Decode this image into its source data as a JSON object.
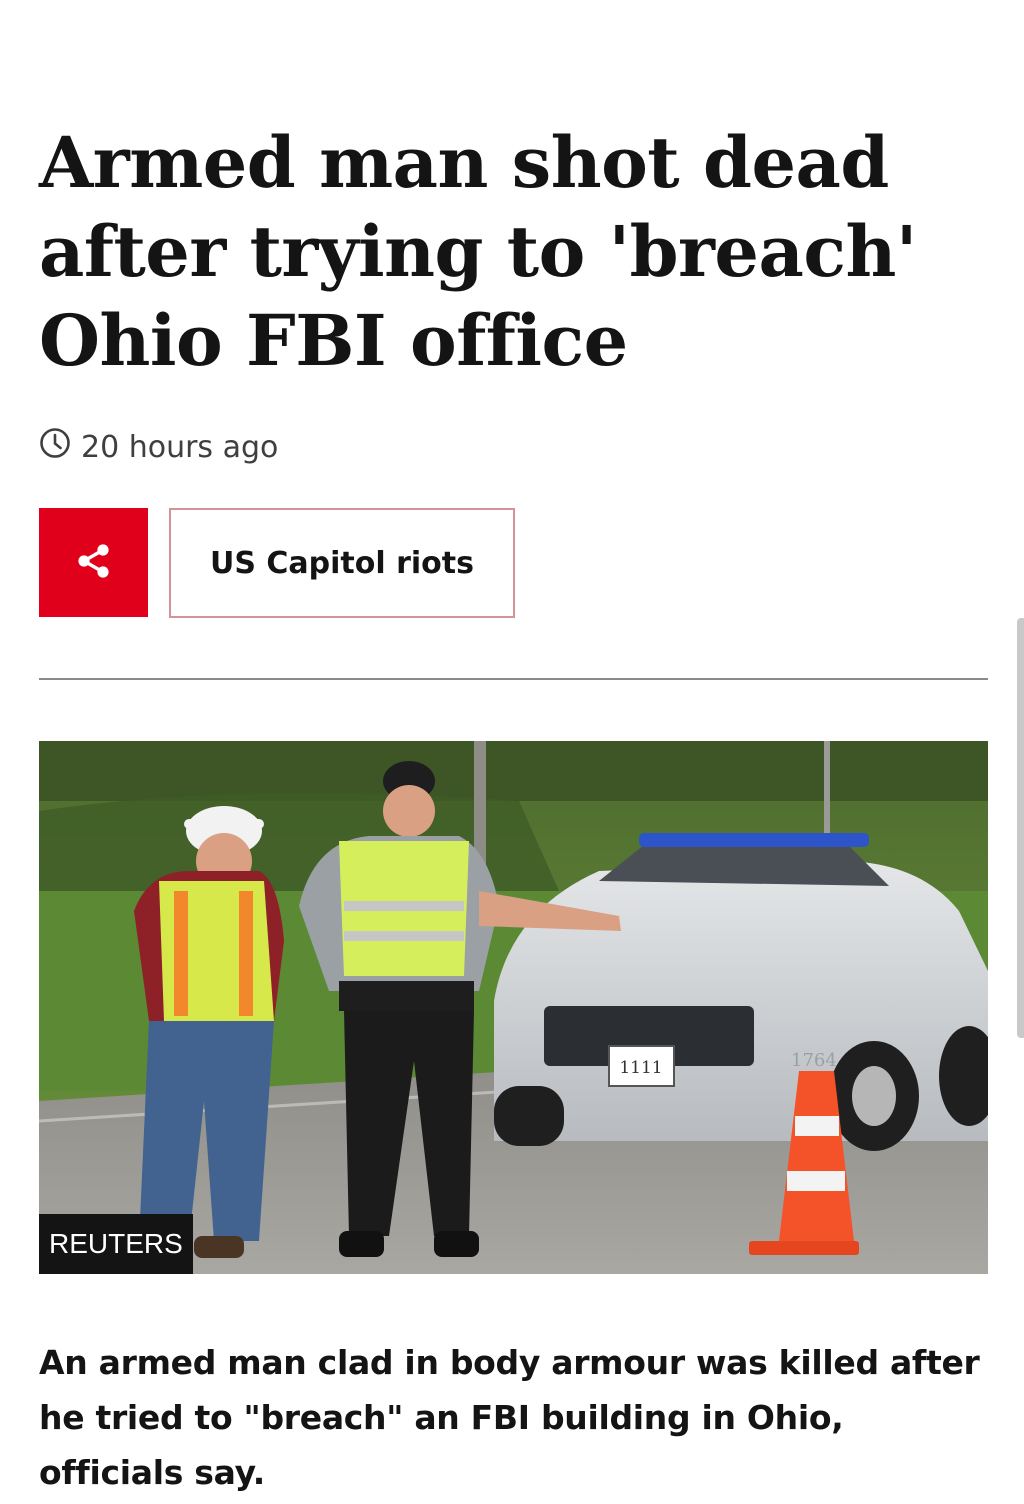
{
  "article": {
    "headline": "Armed man shot dead after trying to 'breach' Ohio FBI office",
    "timestamp": "20 hours ago",
    "topic_label": "US Capitol riots",
    "image_credit": "REUTERS",
    "intro": "An armed man clad in body armour was killed after he tried to \"breach\" an FBI building in Ohio, officials say."
  },
  "icons": {
    "clock": "clock-icon",
    "share": "share-icon"
  },
  "colors": {
    "share_background": "#e0001b",
    "topic_border": "#d29497",
    "text": "#141414",
    "meta_text": "#3f3f42",
    "divider": "#8a8a8a"
  },
  "photo_text": {
    "plate": "1111",
    "car_number": "1764"
  }
}
